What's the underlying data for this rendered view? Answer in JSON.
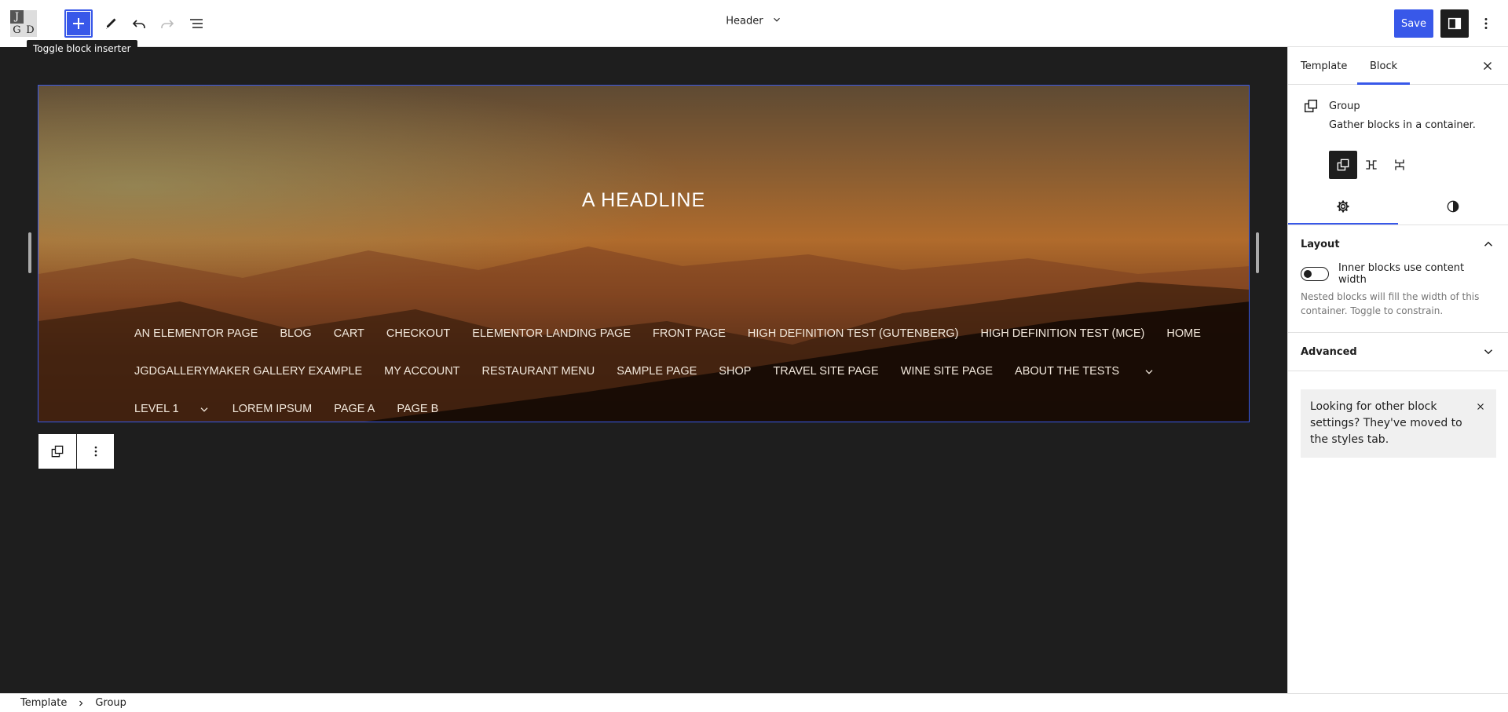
{
  "topbar": {
    "logo_letters": [
      "J",
      "",
      "G",
      "D"
    ],
    "document_title": "Header",
    "save_label": "Save",
    "tooltip": "Toggle block inserter",
    "icons": {
      "inserter": "plus-icon",
      "tools": "pencil-icon",
      "undo": "undo-icon",
      "redo": "redo-icon",
      "list_view": "list-view-icon",
      "settings": "sidebar-icon",
      "options": "more-vertical-icon"
    }
  },
  "canvas": {
    "headline": "A HEADLINE",
    "nav_rows": [
      [
        "AN ELEMENTOR PAGE",
        "BLOG",
        "CART",
        "CHECKOUT",
        "ELEMENTOR LANDING PAGE",
        "FRONT PAGE",
        "HIGH DEFINITION TEST (GUTENBERG)",
        "HIGH DEFINITION TEST (MCE)",
        "HOME"
      ],
      [
        "JGDGALLERYMAKER GALLERY EXAMPLE",
        "MY ACCOUNT",
        "RESTAURANT MENU",
        "SAMPLE PAGE",
        "SHOP",
        "TRAVEL SITE PAGE",
        "WINE SITE PAGE",
        "ABOUT THE TESTS"
      ],
      [
        "LEVEL 1",
        "LOREM IPSUM",
        "PAGE A",
        "PAGE B"
      ]
    ]
  },
  "sidebar": {
    "tabs": [
      "Template",
      "Block"
    ],
    "active_tab": "Block",
    "block_title": "Group",
    "block_description": "Gather blocks in a container.",
    "layout_panel": {
      "title": "Layout",
      "toggle_label": "Inner blocks use content width",
      "toggle_on": false,
      "help": "Nested blocks will fill the width of this container. Toggle to constrain."
    },
    "advanced_panel": {
      "title": "Advanced"
    },
    "notice": "Looking for other block settings? They've moved to the styles tab."
  },
  "breadcrumb": [
    "Template",
    "Group"
  ],
  "colors": {
    "accent": "#3858e9",
    "canvas": "#1e1e1e",
    "text": "#1e1e1e"
  }
}
